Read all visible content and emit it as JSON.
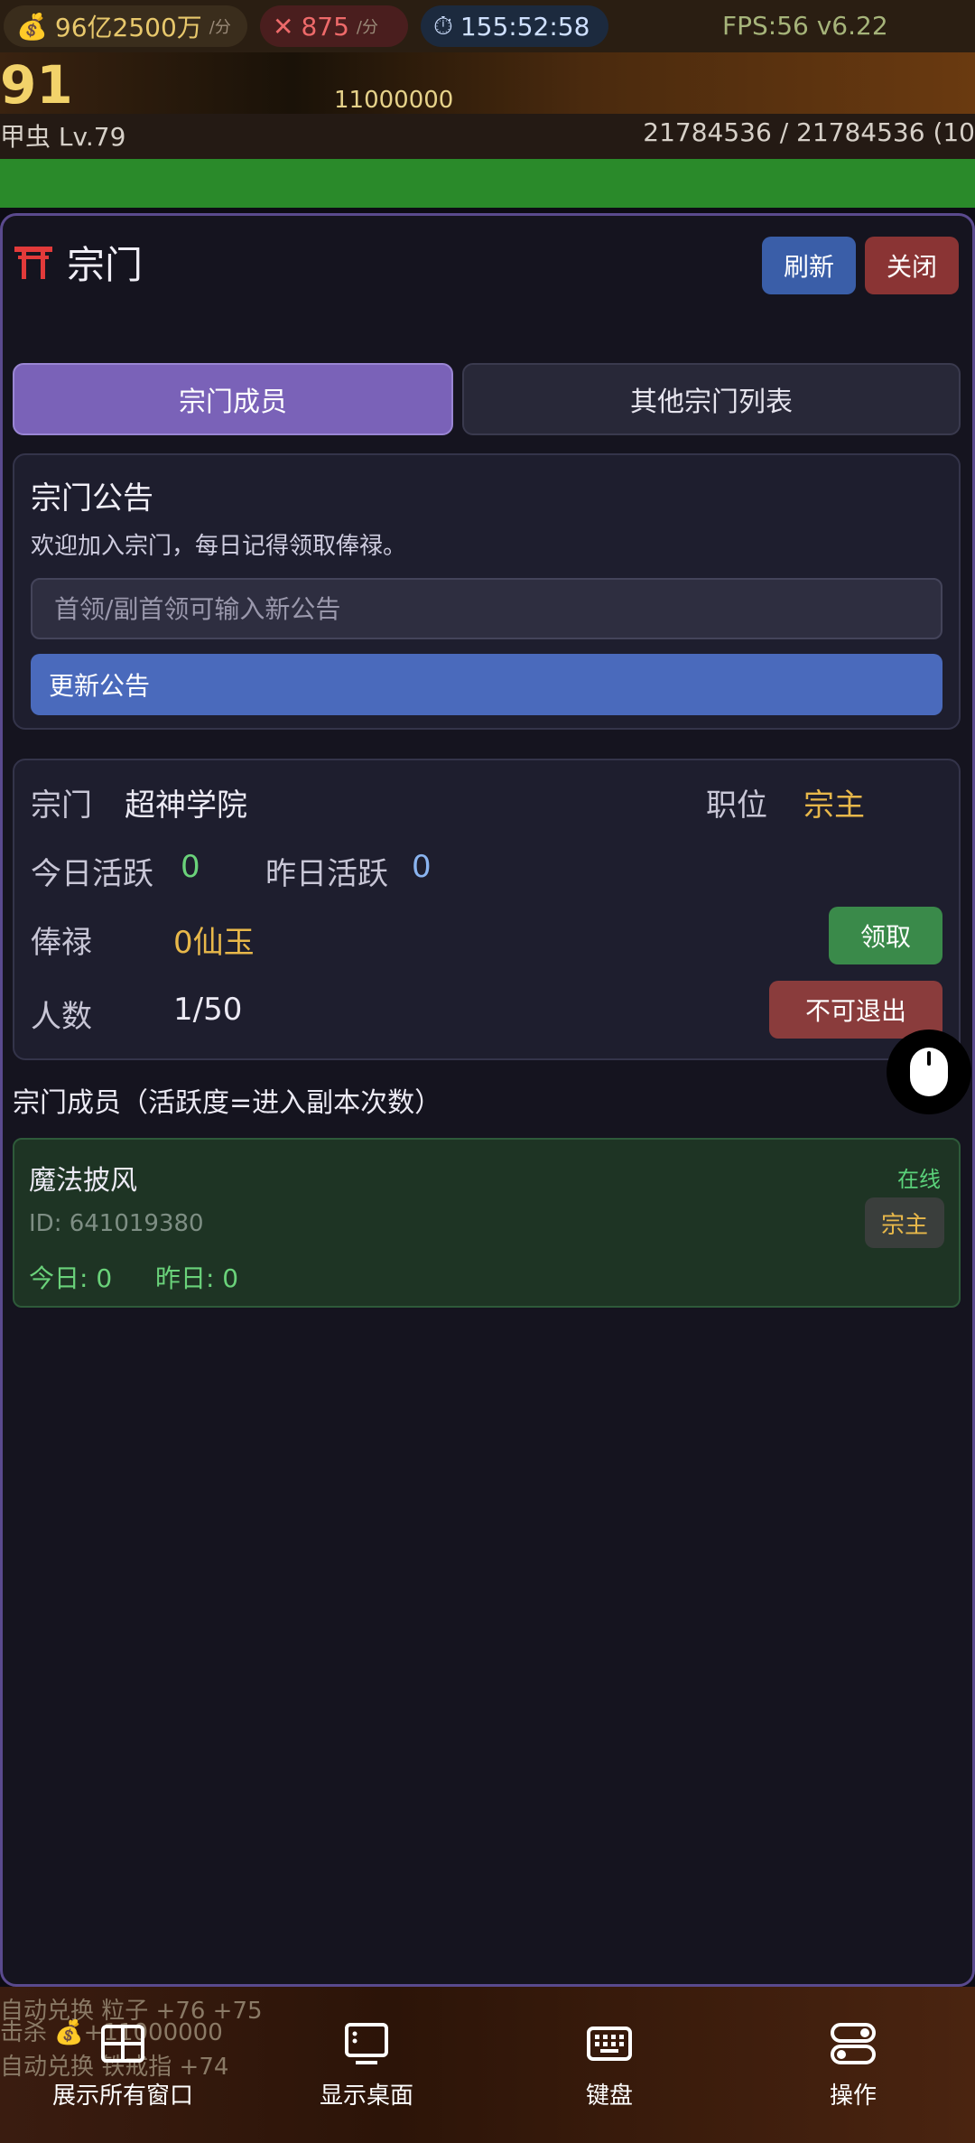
{
  "topbar": {
    "gold": "96亿2500万",
    "gold_rate": "/分",
    "kills": "875",
    "kill_rate": "/分",
    "timer": "155:52:58",
    "fps": "FPS:56 v6.22",
    "big_number": "91",
    "coin_amount": "11000000",
    "level_name": "甲虫 Lv.79",
    "hp_text": "21784536 / 21784536 (10"
  },
  "panel": {
    "title": "宗门",
    "refresh_label": "刷新",
    "close_label": "关闭",
    "tabs": [
      {
        "label": "宗门成员",
        "active": true
      },
      {
        "label": "其他宗门列表",
        "active": false
      }
    ],
    "notice": {
      "title": "宗门公告",
      "text": "欢迎加入宗门，每日记得领取俸禄。",
      "input_placeholder": "首领/副首领可输入新公告",
      "update_label": "更新公告"
    },
    "info": {
      "sect_label": "宗门",
      "sect_name": "超神学院",
      "position_label": "职位",
      "position_value": "宗主",
      "today_active_label": "今日活跃",
      "today_active_value": "0",
      "yesterday_active_label": "昨日活跃",
      "yesterday_active_value": "0",
      "salary_label": "俸禄",
      "salary_value": "0仙玉",
      "claim_label": "领取",
      "members_label": "人数",
      "members_value": "1/50",
      "quit_label": "不可退出"
    },
    "members_title": "宗门成员（活跃度=进入副本次数）",
    "members": [
      {
        "name": "魔法披风",
        "status": "在线",
        "id_text": "ID: 641019380",
        "role": "宗主",
        "today": "今日: 0",
        "yesterday": "昨日: 0"
      }
    ]
  },
  "bottom_log": [
    "自动兑换 粒子 +76 +75",
    "击杀 💰+11000000",
    "自动兑换 铁戒指 +74"
  ],
  "taskbar": {
    "show_all_windows": "展示所有窗口",
    "show_desktop": "显示桌面",
    "keyboard": "键盘",
    "operate": "操作"
  },
  "colors": {
    "accent_purple": "#7a62b8",
    "refresh_blue": "#3a5ea8",
    "close_red": "#8a3434",
    "gold": "#e8b84a",
    "online_green": "#5ad27a",
    "hp_green": "#2a8a2a"
  }
}
